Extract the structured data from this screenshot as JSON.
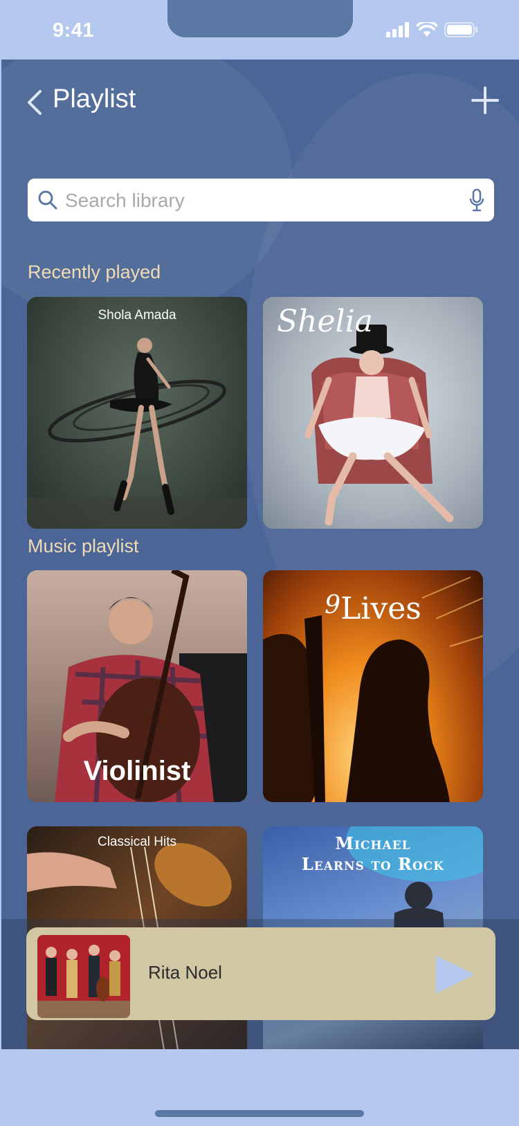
{
  "status": {
    "time": "9:41"
  },
  "header": {
    "title": "Playlist"
  },
  "search": {
    "placeholder": "Search library"
  },
  "sections": {
    "recent": {
      "title": "Recently played"
    },
    "music": {
      "title": "Music playlist"
    }
  },
  "cards": {
    "shola": {
      "title": "Shola Amada"
    },
    "shelia": {
      "title": "Shelia"
    },
    "violinist": {
      "title": "Violinist"
    },
    "lives": {
      "title": "Lives",
      "prefix": "9"
    },
    "classical": {
      "title": "Classical Hits"
    },
    "michael": {
      "title_line1": "Michael",
      "title_line2": "Learns to Rock"
    }
  },
  "player": {
    "track": "Rita Noel"
  },
  "colors": {
    "background": "#b5c9ee",
    "app": "#4a6596",
    "accent": "#f1dcb4",
    "player": "#d2c7a4",
    "play": "#b5c9ee"
  }
}
